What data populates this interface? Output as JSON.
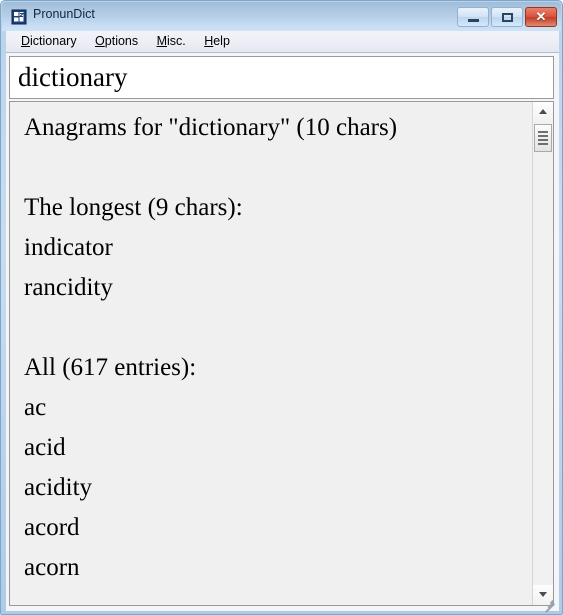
{
  "window": {
    "title": "PronunDict",
    "icon": "app-dictionary-icon",
    "controls": {
      "minimize_label": "–",
      "maximize_label": "□",
      "close_label": "✕"
    }
  },
  "menubar": {
    "items": [
      {
        "label": "Dictionary",
        "accel": "D"
      },
      {
        "label": "Options",
        "accel": "O"
      },
      {
        "label": "Misc.",
        "accel": "M"
      },
      {
        "label": "Help",
        "accel": "H"
      }
    ]
  },
  "search": {
    "value": "dictionary",
    "placeholder": ""
  },
  "results": {
    "heading": "Anagrams for \"dictionary\" (10 chars)",
    "longest_heading": "The longest (9 chars):",
    "longest_words": [
      "indicator",
      "rancidity"
    ],
    "all_heading": "All (617 entries):",
    "all_words": [
      "ac",
      "acid",
      "acidity",
      "acord",
      "acorn"
    ]
  },
  "scrollbar": {
    "up_arrow": "scroll-up-arrow",
    "down_arrow": "scroll-down-arrow",
    "thumb": "scroll-thumb"
  },
  "colors": {
    "title_bar_top": "#9fbbd8",
    "title_bar_bottom": "#cfe2f5",
    "window_border": "#7ba7cf",
    "close_button": "#d9543c",
    "content_bg": "#f0f0f0",
    "input_bg": "#ffffff"
  }
}
